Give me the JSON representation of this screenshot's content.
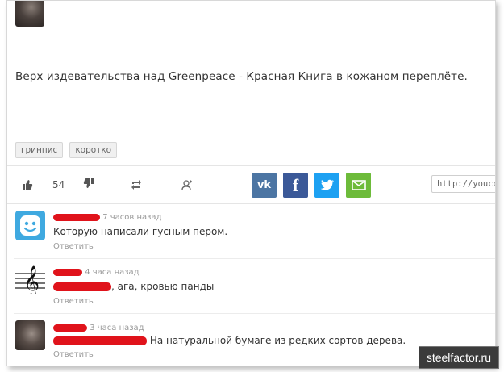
{
  "post": {
    "text": "Верх издевательства над Greenpeace - Красная Книга в кожаном переплёте.",
    "tags": [
      "гринпис",
      "коротко"
    ]
  },
  "actions": {
    "likes_count": "54",
    "url_placeholder": "http://youco"
  },
  "comments": [
    {
      "time": "7 часов назад",
      "text": "Которую написали гусным пером.",
      "reply": "Ответить"
    },
    {
      "time": "4 часа назад",
      "text": ", ага, кровью панды",
      "reply": "Ответить"
    },
    {
      "time": "3 часа назад",
      "text": "На натуральной бумаге из редких сортов дерева.",
      "reply": "Ответить"
    }
  ],
  "watermark": "steelfactor.ru",
  "colors": {
    "vk": "#4c75a3",
    "facebook": "#3b5998",
    "twitter": "#1da1f2",
    "email": "#6dbb3a",
    "redaction": "#e0131b"
  }
}
